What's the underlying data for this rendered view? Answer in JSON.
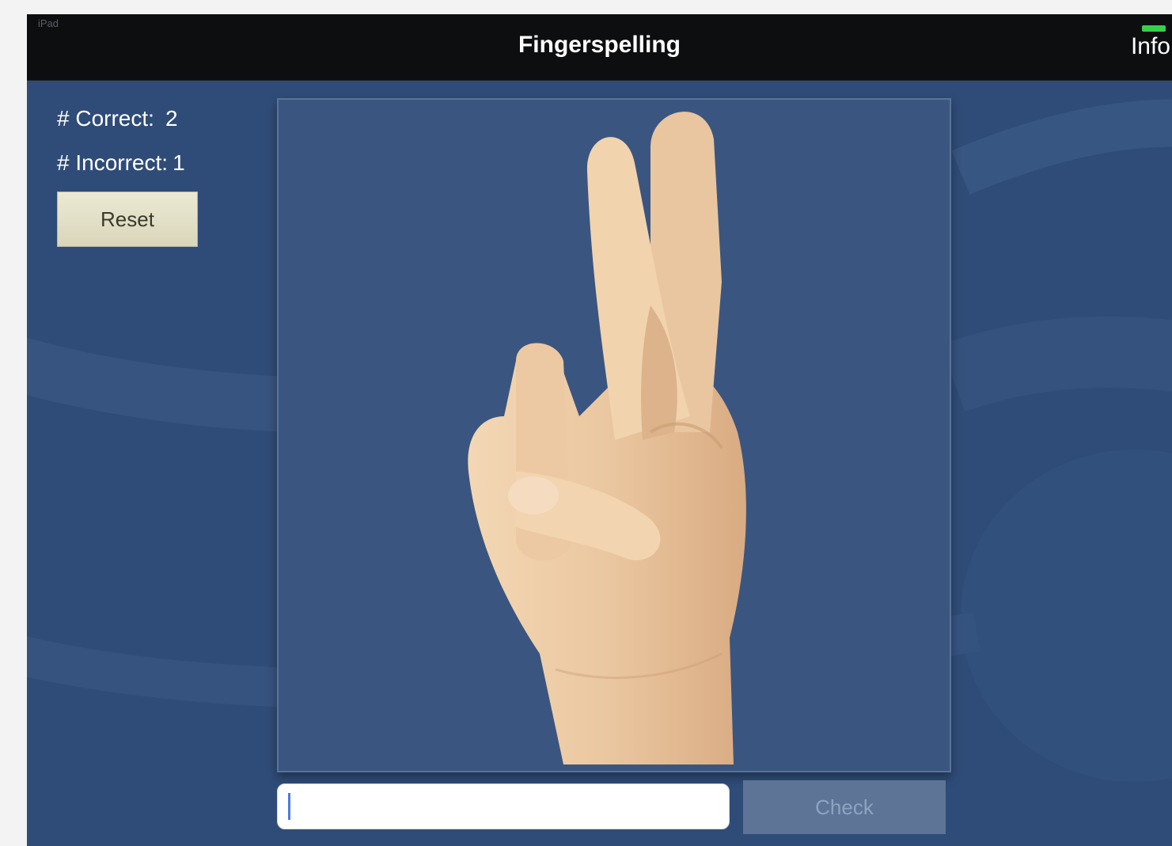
{
  "status_bar": {
    "left_text": "iPad"
  },
  "navbar": {
    "title": "Fingerspelling",
    "info_label": "Info"
  },
  "stats": {
    "correct_label": "# Correct:",
    "correct_value": "2",
    "incorrect_label": "# Incorrect:",
    "incorrect_value": "1"
  },
  "reset_label": "Reset",
  "answer": {
    "value": "",
    "placeholder": ""
  },
  "check_label": "Check",
  "colors": {
    "background": "#2f4c78",
    "panel": "#3a5680",
    "navbar": "#0d0e10",
    "battery": "#35d04a",
    "reset_button": "#e3e0c8"
  }
}
